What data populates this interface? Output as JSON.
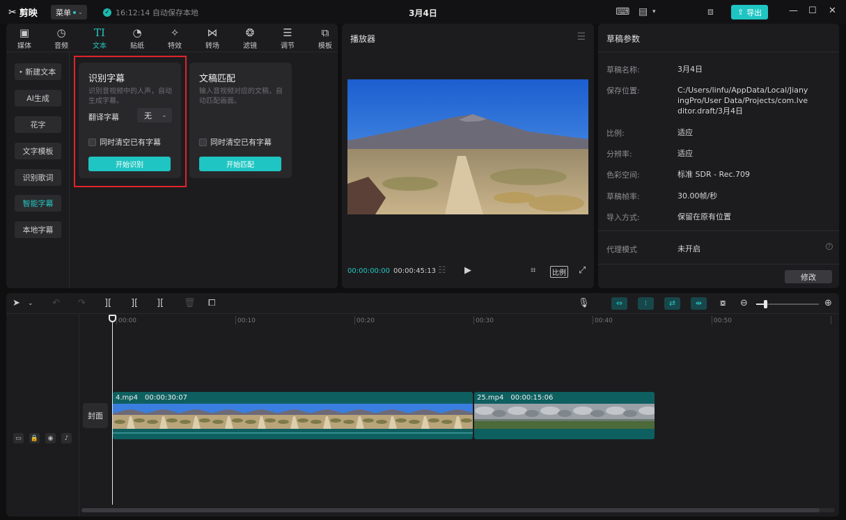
{
  "app": {
    "name": "剪映",
    "menu_label": "菜单",
    "save_status": "16:12:14 自动保存本地",
    "project_title": "3月4日",
    "export_label": "导出"
  },
  "toolbar": {
    "tabs": [
      {
        "label": "媒体",
        "icon": "media-icon"
      },
      {
        "label": "音频",
        "icon": "audio-icon"
      },
      {
        "label": "文本",
        "icon": "text-icon",
        "active": true
      },
      {
        "label": "贴纸",
        "icon": "sticker-icon"
      },
      {
        "label": "特效",
        "icon": "effects-icon"
      },
      {
        "label": "转场",
        "icon": "transition-icon"
      },
      {
        "label": "滤镜",
        "icon": "filter-icon"
      },
      {
        "label": "调节",
        "icon": "adjust-icon"
      },
      {
        "label": "模板",
        "icon": "template-icon"
      }
    ]
  },
  "subnav": {
    "items": [
      {
        "label": "新建文本"
      },
      {
        "label": "AI生成"
      },
      {
        "label": "花字"
      },
      {
        "label": "文字模板"
      },
      {
        "label": "识别歌词"
      },
      {
        "label": "智能字幕",
        "active": true
      },
      {
        "label": "本地字幕"
      }
    ]
  },
  "cards": {
    "recognize": {
      "title": "识别字幕",
      "desc": "识别音视频中的人声，自动生成字幕。",
      "translate_label": "翻译字幕",
      "translate_value": "无",
      "clear_label": "同时清空已有字幕",
      "button": "开始识别"
    },
    "match": {
      "title": "文稿匹配",
      "desc": "输入音视频对应的文稿，自动匹配画面。",
      "clear_label": "同时清空已有字幕",
      "button": "开始匹配"
    }
  },
  "player": {
    "title": "播放器",
    "current_time": "00:00:00:00",
    "duration": "00:00:45:13",
    "ratio_label": "比例"
  },
  "params": {
    "title": "草稿参数",
    "rows": [
      {
        "label": "草稿名称:",
        "value": "3月4日"
      },
      {
        "label": "保存位置:",
        "value": "C:/Users/linfu/AppData/Local/JianyingPro/User Data/Projects/com.lveditor.draft/3月4日"
      },
      {
        "label": "比例:",
        "value": "适应"
      },
      {
        "label": "分辨率:",
        "value": "适应"
      },
      {
        "label": "色彩空间:",
        "value": "标准 SDR - Rec.709"
      },
      {
        "label": "草稿帧率:",
        "value": "30.00帧/秒"
      },
      {
        "label": "导入方式:",
        "value": "保留在原有位置"
      }
    ],
    "proxy_label": "代理模式",
    "proxy_value": "未开启",
    "modify_label": "修改"
  },
  "timeline": {
    "cover_label": "封面",
    "ruler": [
      "00:00",
      "00:10",
      "00:20",
      "00:30",
      "00:40",
      "00:50"
    ],
    "clips": [
      {
        "name": "4.mp4",
        "duration": "00:00:30:07"
      },
      {
        "name": "25.mp4",
        "duration": "00:00:15:06"
      }
    ]
  }
}
